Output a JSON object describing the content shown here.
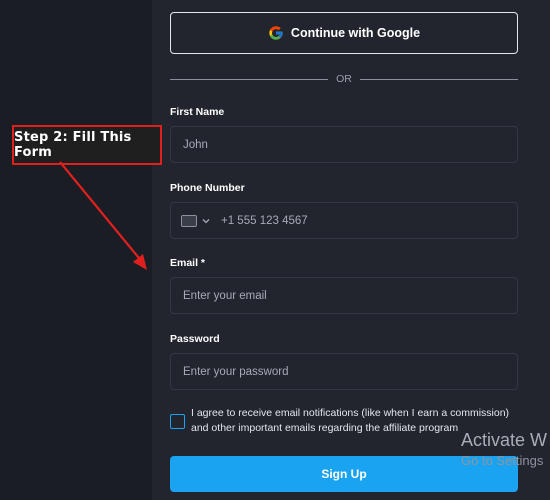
{
  "google_button": {
    "label": "Continue with Google",
    "icon": "google-icon"
  },
  "divider": {
    "text": "OR"
  },
  "form": {
    "first_name": {
      "label": "First Name",
      "placeholder": "John"
    },
    "phone": {
      "label": "Phone Number",
      "placeholder": "+1 555 123 4567",
      "flag_icon": "flag-icon"
    },
    "email": {
      "label": "Email *",
      "placeholder": "Enter your email"
    },
    "password": {
      "label": "Password",
      "placeholder": "Enter your password"
    },
    "agree_text": "I agree to receive email notifications (like when I earn a commission) and other important emails regarding the affiliate program",
    "submit_label": "Sign Up"
  },
  "annotation": {
    "text": "Step 2: Fill This Form",
    "color": "#e0201f"
  },
  "watermark": {
    "line1": "Activate W",
    "line2": "Go to Settings"
  },
  "colors": {
    "accent": "#1aa3f0",
    "background": "#1a1d24",
    "panel": "#22252e"
  }
}
